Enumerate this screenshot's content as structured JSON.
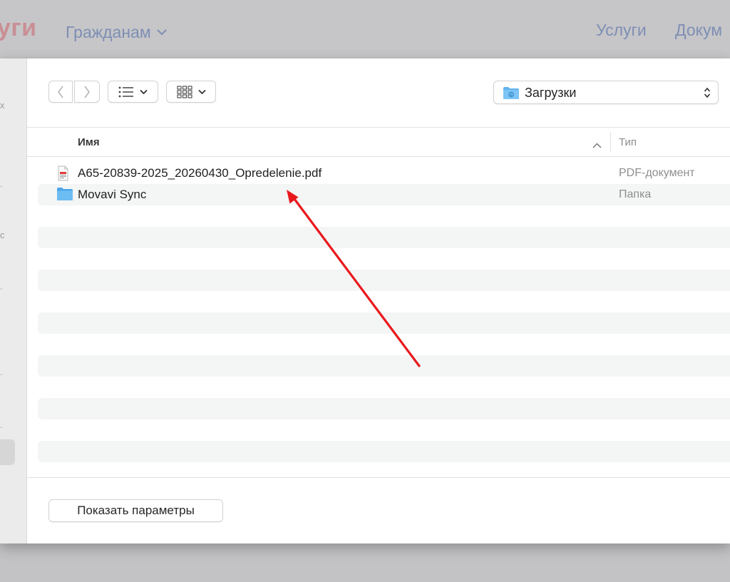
{
  "site": {
    "logo_text": "уги",
    "nav_citizens": "Гражданам",
    "nav_services": "Услуги",
    "nav_documents": "Докум"
  },
  "sidebar_glyphs": [
    "x",
    ".",
    "с",
    ".",
    ".",
    "."
  ],
  "toolbar": {
    "back_icon": "chevron-left-icon",
    "forward_icon": "chevron-right-icon",
    "list_view_icon": "list-icon",
    "grid_view_icon": "grid-icon",
    "location_label": "Загрузки"
  },
  "columns": {
    "name": "Имя",
    "type": "Тип"
  },
  "files": [
    {
      "name": "A65-20839-2025_20260430_Opredelenie.pdf",
      "type": "PDF-документ",
      "icon": "pdf-file-icon"
    },
    {
      "name": "Movavi Sync",
      "type": "Папка",
      "icon": "folder-icon"
    }
  ],
  "footer": {
    "options_label": "Показать параметры"
  },
  "colors": {
    "folder_blue": "#5fb3ef",
    "annotation_red": "#e8181c",
    "stripe": "#f4f5f5"
  }
}
